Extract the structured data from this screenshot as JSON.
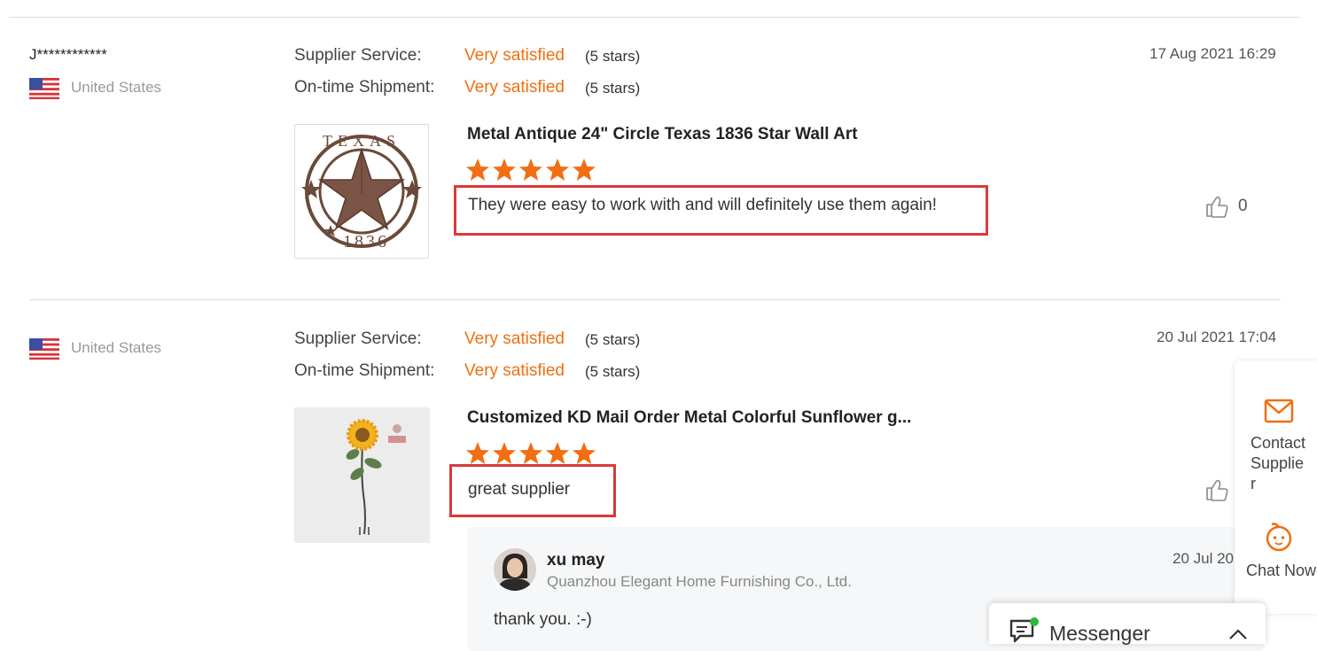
{
  "reviews": [
    {
      "reviewer": "J************",
      "country": "United States",
      "supplier_service_label": "Supplier Service:",
      "supplier_service_value": "Very satisfied",
      "supplier_service_stars": "(5 stars)",
      "shipment_label": "On-time Shipment:",
      "shipment_value": "Very satisfied",
      "shipment_stars": "(5 stars)",
      "date": "17 Aug 2021 16:29",
      "product_title": "Metal Antique 24\" Circle Texas 1836 Star Wall Art",
      "rating": 5,
      "text": "They were easy to work with and will definitely use them again!",
      "likes": "0",
      "product_image_text_top": "TEXAS",
      "product_image_text_bottom": "1836"
    },
    {
      "country": "United States",
      "supplier_service_label": "Supplier Service:",
      "supplier_service_value": "Very satisfied",
      "supplier_service_stars": "(5 stars)",
      "shipment_label": "On-time Shipment:",
      "shipment_value": "Very satisfied",
      "shipment_stars": "(5 stars)",
      "date": "20 Jul 2021 17:04",
      "product_title": "Customized KD Mail Order Metal Colorful Sunflower g...",
      "rating": 5,
      "text": "great supplier",
      "reply": {
        "name": "xu may",
        "company": "Quanzhou Elegant Home Furnishing Co., Ltd.",
        "date": "20 Jul 20",
        "text": "thank you. :-)"
      }
    }
  ],
  "side_panel": {
    "contact_label": "Contact Supplie r",
    "chat_label": "Chat Now"
  },
  "messenger": {
    "label": "Messenger"
  },
  "colors": {
    "accent": "#f06f12",
    "highlight_box": "#d93a3a"
  }
}
